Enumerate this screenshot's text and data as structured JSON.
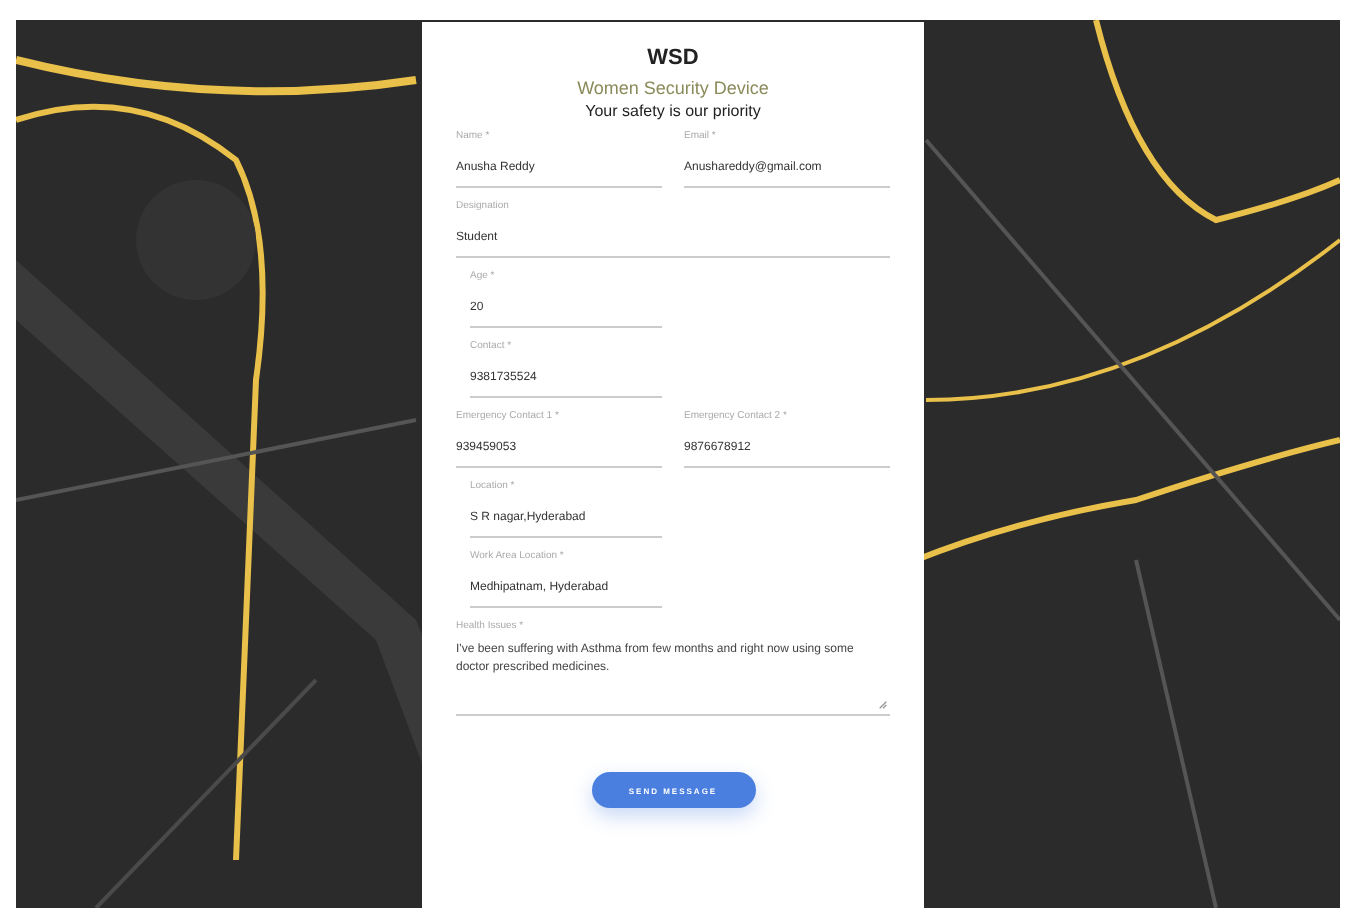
{
  "header": {
    "title": "WSD",
    "subtitle": "Women Security Device",
    "tagline": "Your safety is our priority"
  },
  "rows": [
    {
      "kind": "pair",
      "fields": [
        {
          "label": "Name *",
          "value": "Anusha Reddy"
        },
        {
          "label": "Email *",
          "value": "Anushareddy@gmail.com"
        }
      ]
    },
    {
      "kind": "full",
      "fields": [
        {
          "label": "Designation",
          "value": "Student"
        }
      ]
    },
    {
      "kind": "indented",
      "fields": [
        {
          "label": "Age *",
          "value": "20"
        }
      ]
    },
    {
      "kind": "indented",
      "fields": [
        {
          "label": "Contact *",
          "value": "9381735524"
        }
      ]
    },
    {
      "kind": "pair",
      "fields": [
        {
          "label": "Emergency Contact 1 *",
          "value": "939459053"
        },
        {
          "label": "Emergency Contact 2 *",
          "value": "9876678912"
        }
      ]
    },
    {
      "kind": "indented",
      "fields": [
        {
          "label": "Location *",
          "value": "S R nagar,Hyderabad"
        }
      ]
    },
    {
      "kind": "indented",
      "fields": [
        {
          "label": "Work Area Location *",
          "value": "Medhipatnam, Hyderabad"
        }
      ]
    },
    {
      "kind": "textarea",
      "fields": [
        {
          "label": "Health Issues *",
          "value": "I've been suffering with Asthma from few months and right now using some doctor prescribed medicines."
        }
      ]
    }
  ],
  "button": "SEND MESSAGE"
}
